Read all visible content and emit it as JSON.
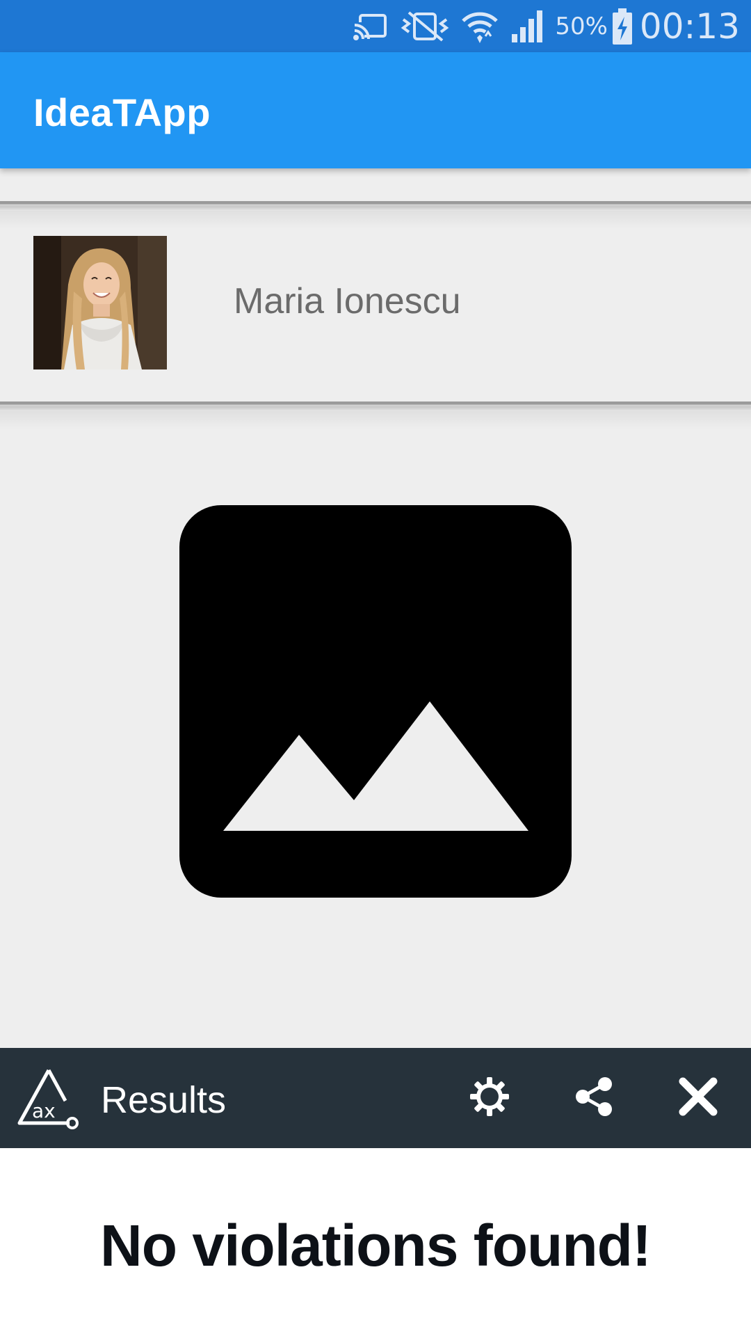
{
  "status_bar": {
    "battery": "50%",
    "time": "00:13",
    "icons": [
      "cast-icon",
      "vibrate-icon",
      "wifi-icon",
      "cellular-signal-icon",
      "battery-charging-icon"
    ]
  },
  "app_bar": {
    "title": "IdeaTApp"
  },
  "profile": {
    "name": "Maria Ionescu"
  },
  "content": {
    "placeholder_icon": "image-placeholder-icon"
  },
  "results_panel": {
    "title": "Results",
    "actions": [
      "settings-icon",
      "share-icon",
      "close-icon"
    ],
    "message": "No violations found!"
  },
  "colors": {
    "status_bar": "#1e77d3",
    "app_bar": "#2196f3",
    "background": "#eeeeee",
    "results_bar": "#26323b",
    "results_content": "#ffffff"
  }
}
